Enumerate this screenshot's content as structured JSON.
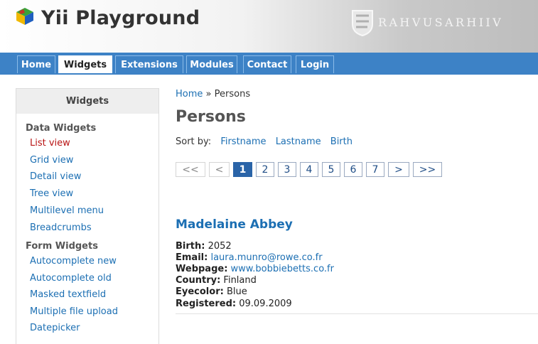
{
  "header": {
    "app_title": "Yii Playground",
    "brand_text": "RAHVUSARHIIV"
  },
  "nav": {
    "items": [
      {
        "label": "Home",
        "active": false
      },
      {
        "label": "Widgets",
        "active": true
      },
      {
        "label": "Extensions",
        "active": false
      },
      {
        "label": "Modules",
        "active": false
      },
      {
        "label": "Contact",
        "active": false
      },
      {
        "label": "Login",
        "active": false
      }
    ]
  },
  "sidebar": {
    "title": "Widgets",
    "sections": [
      {
        "title": "Data Widgets",
        "items": [
          "List view",
          "Grid view",
          "Detail view",
          "Tree view",
          "Multilevel menu",
          "Breadcrumbs"
        ]
      },
      {
        "title": "Form Widgets",
        "items": [
          "Autocomplete new",
          "Autocomplete old",
          "Masked textfield",
          "Multiple file upload",
          "Datepicker"
        ]
      }
    ],
    "active_item": "List view"
  },
  "breadcrumb": {
    "home": "Home",
    "separator": "»",
    "current": "Persons"
  },
  "page_title": "Persons",
  "sort": {
    "label": "Sort by:",
    "options": [
      "Firstname",
      "Lastname",
      "Birth"
    ]
  },
  "pager": {
    "first": "<<",
    "prev": "<",
    "pages": [
      "1",
      "2",
      "3",
      "4",
      "5",
      "6",
      "7"
    ],
    "current_page": "1",
    "next": ">",
    "last": ">>"
  },
  "person": {
    "name": "Madelaine Abbey",
    "fields": [
      {
        "label": "Birth:",
        "value": "2052",
        "link": false
      },
      {
        "label": "Email:",
        "value": "laura.munro@rowe.co.fr",
        "link": true
      },
      {
        "label": "Webpage:",
        "value": "www.bobbiebetts.co.fr",
        "link": true
      },
      {
        "label": "Country:",
        "value": "Finland",
        "link": false
      },
      {
        "label": "Eyecolor:",
        "value": "Blue",
        "link": false
      },
      {
        "label": "Registered:",
        "value": "09.09.2009",
        "link": false
      }
    ]
  },
  "colors": {
    "nav_bg": "#3d82c6",
    "link": "#1c6fb3",
    "active_link": "#b81414",
    "pager_selected": "#2a64a8"
  }
}
